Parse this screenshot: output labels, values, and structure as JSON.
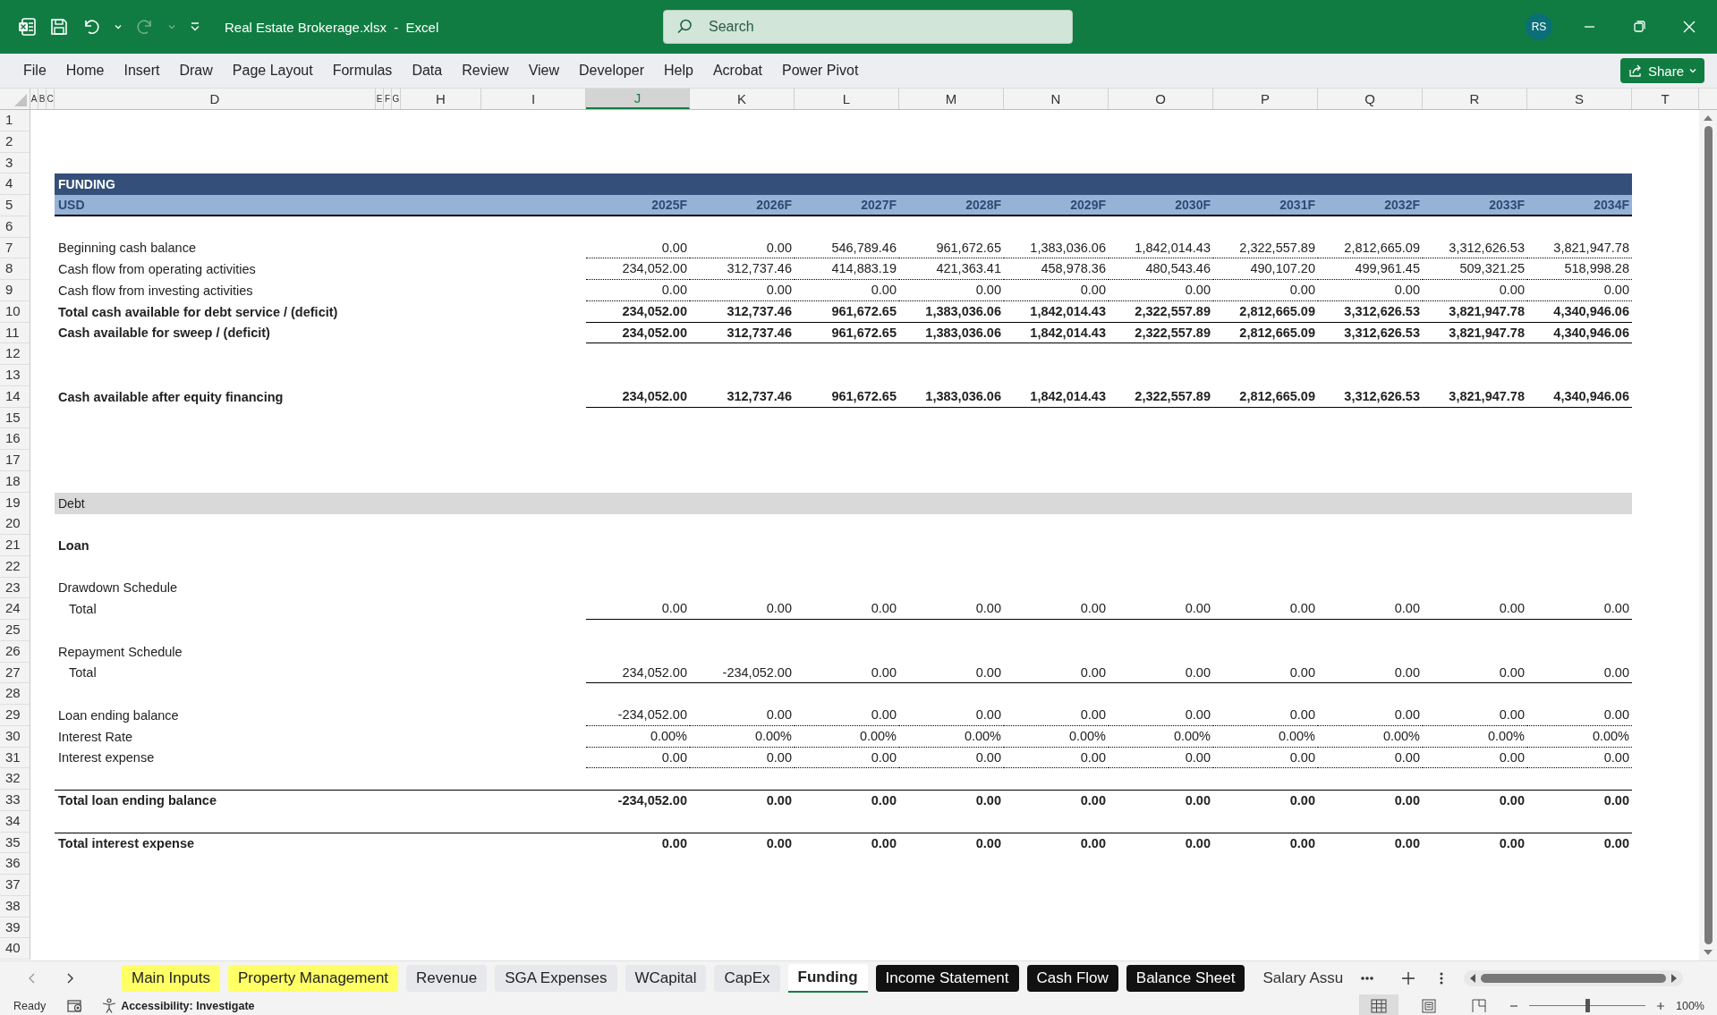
{
  "window": {
    "title": "Real Estate Brokerage.xlsx  -  Excel",
    "search": {
      "placeholder": "Search"
    },
    "avatar": "RS"
  },
  "ribbon": {
    "tabs": [
      "File",
      "Home",
      "Insert",
      "Draw",
      "Page Layout",
      "Formulas",
      "Data",
      "Review",
      "View",
      "Developer",
      "Help",
      "Acrobat",
      "Power Pivot"
    ],
    "share": "Share"
  },
  "columns": [
    {
      "letter": "A",
      "selected": false
    },
    {
      "letter": "B",
      "selected": false
    },
    {
      "letter": "C",
      "selected": false
    },
    {
      "letter": "D",
      "selected": false
    },
    {
      "letter": "E",
      "selected": false
    },
    {
      "letter": "F",
      "selected": false
    },
    {
      "letter": "G",
      "selected": false
    },
    {
      "letter": "H",
      "selected": false
    },
    {
      "letter": "I",
      "selected": false
    },
    {
      "letter": "J",
      "selected": true
    },
    {
      "letter": "K",
      "selected": false
    },
    {
      "letter": "L",
      "selected": false
    },
    {
      "letter": "M",
      "selected": false
    },
    {
      "letter": "N",
      "selected": false
    },
    {
      "letter": "O",
      "selected": false
    },
    {
      "letter": "P",
      "selected": false
    },
    {
      "letter": "Q",
      "selected": false
    },
    {
      "letter": "R",
      "selected": false
    },
    {
      "letter": "S",
      "selected": false
    },
    {
      "letter": "T",
      "selected": false
    }
  ],
  "sheet": {
    "rows": [
      {
        "number": "1",
        "kind": "blank"
      },
      {
        "number": "2",
        "kind": "blank"
      },
      {
        "number": "3",
        "kind": "blank"
      },
      {
        "number": "4",
        "kind": "banner",
        "label": "FUNDING"
      },
      {
        "number": "5",
        "kind": "header",
        "label": "USD",
        "years": [
          "2025F",
          "2026F",
          "2027F",
          "2028F",
          "2029F",
          "2030F",
          "2031F",
          "2032F",
          "2033F",
          "2034F"
        ]
      },
      {
        "number": "6",
        "kind": "blank"
      },
      {
        "number": "7",
        "kind": "line",
        "label": "Beginning cash balance",
        "bold": false,
        "indent": false,
        "border_above": false,
        "underline": true,
        "dotted": true,
        "values": [
          "0.00",
          "0.00",
          "546,789.46",
          "961,672.65",
          "1,383,036.06",
          "1,842,014.43",
          "2,322,557.89",
          "2,812,665.09",
          "3,312,626.53",
          "3,821,947.78"
        ]
      },
      {
        "number": "8",
        "kind": "line",
        "label": "Cash flow from operating activities",
        "bold": false,
        "indent": false,
        "border_above": false,
        "underline": true,
        "dotted": true,
        "values": [
          "234,052.00",
          "312,737.46",
          "414,883.19",
          "421,363.41",
          "458,978.36",
          "480,543.46",
          "490,107.20",
          "499,961.45",
          "509,321.25",
          "518,998.28"
        ]
      },
      {
        "number": "9",
        "kind": "line",
        "label": "Cash flow from investing activities",
        "bold": false,
        "indent": false,
        "border_above": false,
        "underline": true,
        "dotted": true,
        "values": [
          "0.00",
          "0.00",
          "0.00",
          "0.00",
          "0.00",
          "0.00",
          "0.00",
          "0.00",
          "0.00",
          "0.00"
        ]
      },
      {
        "number": "10",
        "kind": "line",
        "label": "Total cash available for debt service / (deficit)",
        "bold": true,
        "indent": false,
        "border_above": false,
        "underline": true,
        "dotted": false,
        "values": [
          "234,052.00",
          "312,737.46",
          "961,672.65",
          "1,383,036.06",
          "1,842,014.43",
          "2,322,557.89",
          "2,812,665.09",
          "3,312,626.53",
          "3,821,947.78",
          "4,340,946.06"
        ]
      },
      {
        "number": "11",
        "kind": "line",
        "label": "Cash available for sweep / (deficit)",
        "bold": true,
        "indent": false,
        "border_above": false,
        "underline": true,
        "dotted": false,
        "values": [
          "234,052.00",
          "312,737.46",
          "961,672.65",
          "1,383,036.06",
          "1,842,014.43",
          "2,322,557.89",
          "2,812,665.09",
          "3,312,626.53",
          "3,821,947.78",
          "4,340,946.06"
        ]
      },
      {
        "number": "12",
        "kind": "blank"
      },
      {
        "number": "13",
        "kind": "blank"
      },
      {
        "number": "14",
        "kind": "line",
        "label": "Cash available after equity financing",
        "bold": true,
        "indent": false,
        "border_above": false,
        "underline": true,
        "dotted": false,
        "values": [
          "234,052.00",
          "312,737.46",
          "961,672.65",
          "1,383,036.06",
          "1,842,014.43",
          "2,322,557.89",
          "2,812,665.09",
          "3,312,626.53",
          "3,821,947.78",
          "4,340,946.06"
        ]
      },
      {
        "number": "15",
        "kind": "blank"
      },
      {
        "number": "16",
        "kind": "blank"
      },
      {
        "number": "17",
        "kind": "blank"
      },
      {
        "number": "18",
        "kind": "blank"
      },
      {
        "number": "19",
        "kind": "band",
        "label": "Debt"
      },
      {
        "number": "20",
        "kind": "blank"
      },
      {
        "number": "21",
        "kind": "label",
        "label": "Loan",
        "bold": true
      },
      {
        "number": "22",
        "kind": "blank"
      },
      {
        "number": "23",
        "kind": "label",
        "label": "Drawdown Schedule",
        "bold": false
      },
      {
        "number": "24",
        "kind": "line",
        "label": "Total",
        "bold": false,
        "indent": true,
        "border_above": false,
        "underline": true,
        "dotted": false,
        "values": [
          "0.00",
          "0.00",
          "0.00",
          "0.00",
          "0.00",
          "0.00",
          "0.00",
          "0.00",
          "0.00",
          "0.00"
        ]
      },
      {
        "number": "25",
        "kind": "blank"
      },
      {
        "number": "26",
        "kind": "label",
        "label": "Repayment Schedule",
        "bold": false
      },
      {
        "number": "27",
        "kind": "line",
        "label": "Total",
        "bold": false,
        "indent": true,
        "border_above": false,
        "underline": true,
        "dotted": false,
        "values": [
          "234,052.00",
          "-234,052.00",
          "0.00",
          "0.00",
          "0.00",
          "0.00",
          "0.00",
          "0.00",
          "0.00",
          "0.00"
        ]
      },
      {
        "number": "28",
        "kind": "blank"
      },
      {
        "number": "29",
        "kind": "line",
        "label": "Loan ending balance",
        "bold": false,
        "indent": false,
        "border_above": false,
        "underline": true,
        "dotted": true,
        "values": [
          "-234,052.00",
          "0.00",
          "0.00",
          "0.00",
          "0.00",
          "0.00",
          "0.00",
          "0.00",
          "0.00",
          "0.00"
        ]
      },
      {
        "number": "30",
        "kind": "line",
        "label": "Interest Rate",
        "bold": false,
        "indent": false,
        "border_above": false,
        "underline": true,
        "dotted": true,
        "values": [
          "0.00%",
          "0.00%",
          "0.00%",
          "0.00%",
          "0.00%",
          "0.00%",
          "0.00%",
          "0.00%",
          "0.00%",
          "0.00%"
        ]
      },
      {
        "number": "31",
        "kind": "line",
        "label": "Interest expense",
        "bold": false,
        "indent": false,
        "border_above": false,
        "underline": true,
        "dotted": true,
        "values": [
          "0.00",
          "0.00",
          "0.00",
          "0.00",
          "0.00",
          "0.00",
          "0.00",
          "0.00",
          "0.00",
          "0.00"
        ]
      },
      {
        "number": "32",
        "kind": "blank"
      },
      {
        "number": "33",
        "kind": "line",
        "label": "Total loan ending balance",
        "bold": true,
        "indent": false,
        "border_above": true,
        "underline": false,
        "values": [
          "-234,052.00",
          "0.00",
          "0.00",
          "0.00",
          "0.00",
          "0.00",
          "0.00",
          "0.00",
          "0.00",
          "0.00"
        ]
      },
      {
        "number": "34",
        "kind": "blank"
      },
      {
        "number": "35",
        "kind": "line",
        "label": "Total interest expense",
        "bold": true,
        "indent": false,
        "border_above": true,
        "underline": false,
        "values": [
          "0.00",
          "0.00",
          "0.00",
          "0.00",
          "0.00",
          "0.00",
          "0.00",
          "0.00",
          "0.00",
          "0.00"
        ]
      },
      {
        "number": "36",
        "kind": "blank"
      },
      {
        "number": "37",
        "kind": "blank"
      },
      {
        "number": "38",
        "kind": "blank"
      },
      {
        "number": "39",
        "kind": "blank"
      },
      {
        "number": "40",
        "kind": "blank"
      }
    ]
  },
  "sheet_tabs": [
    {
      "label": "Main Inputs",
      "kind": "highlighted",
      "selected": false
    },
    {
      "label": "Property Management",
      "kind": "highlighted",
      "selected": false
    },
    {
      "label": "Revenue",
      "kind": "plain",
      "selected": false
    },
    {
      "label": "SGA Expenses",
      "kind": "plain",
      "selected": false
    },
    {
      "label": "WCapital",
      "kind": "plain",
      "selected": false
    },
    {
      "label": "CapEx",
      "kind": "plain",
      "selected": false
    },
    {
      "label": "Funding",
      "kind": "plain",
      "selected": true
    },
    {
      "label": "Income Statement",
      "kind": "dark",
      "selected": false
    },
    {
      "label": "Cash Flow",
      "kind": "dark",
      "selected": false
    },
    {
      "label": "Balance Sheet",
      "kind": "dark",
      "selected": false
    },
    {
      "label": "Salary Assu",
      "kind": "clipped",
      "selected": false
    }
  ],
  "status_bar": {
    "state": "Ready",
    "accessibility": "Accessibility: Investigate",
    "view_buttons": [
      {
        "selected": true
      },
      {
        "selected": false
      },
      {
        "selected": false
      }
    ],
    "zoom": {
      "level": 0.5,
      "reading": "100%"
    }
  }
}
